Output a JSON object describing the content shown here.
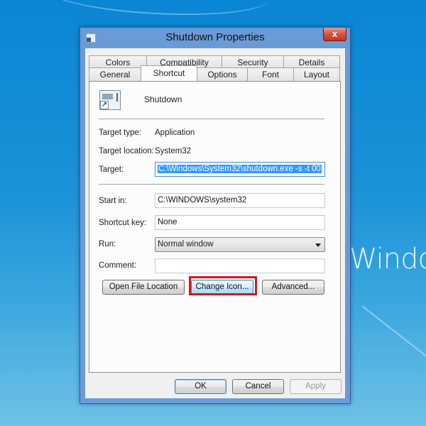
{
  "desktop": {
    "brand_text": "Windo"
  },
  "window": {
    "title": "Shutdown Properties",
    "close_label": "x"
  },
  "tabs": {
    "back_row": [
      {
        "label": "Colors"
      },
      {
        "label": "Compatibility"
      },
      {
        "label": "Security"
      },
      {
        "label": "Details"
      }
    ],
    "front_row": [
      {
        "label": "General"
      },
      {
        "label": "Shortcut",
        "active": true
      },
      {
        "label": "Options"
      },
      {
        "label": "Font"
      },
      {
        "label": "Layout"
      }
    ]
  },
  "shortcut": {
    "app_name": "Shutdown",
    "target_type_label": "Target type:",
    "target_type_value": "Application",
    "target_location_label": "Target location:",
    "target_location_value": "System32",
    "target_label": "Target:",
    "target_value": "C:\\Windows\\System32\\shutdown.exe -s -t 00",
    "start_in_label": "Start in:",
    "start_in_value": "C:\\WINDOWS\\system32",
    "shortcut_key_label": "Shortcut key:",
    "shortcut_key_value": "None",
    "run_label": "Run:",
    "run_value": "Normal window",
    "comment_label": "Comment:",
    "comment_value": "",
    "open_file_location": "Open File Location",
    "change_icon": "Change Icon...",
    "advanced": "Advanced..."
  },
  "footer": {
    "ok": "OK",
    "cancel": "Cancel",
    "apply": "Apply"
  },
  "colors": {
    "highlight_box": "#d7161f",
    "selection": "#3399ff"
  }
}
